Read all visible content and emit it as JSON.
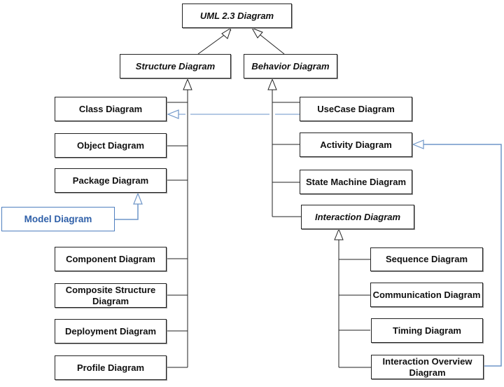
{
  "diagram": {
    "title": "UML 2.3 Diagram",
    "nodes": [
      {
        "id": "uml",
        "label": "UML 2.3 Diagram",
        "abstract": true
      },
      {
        "id": "structure",
        "label": "Structure Diagram",
        "abstract": true
      },
      {
        "id": "behavior",
        "label": "Behavior Diagram",
        "abstract": true
      },
      {
        "id": "class",
        "label": "Class Diagram",
        "abstract": false
      },
      {
        "id": "object",
        "label": "Object Diagram",
        "abstract": false
      },
      {
        "id": "package",
        "label": "Package Diagram",
        "abstract": false
      },
      {
        "id": "model",
        "label": "Model Diagram",
        "abstract": false,
        "highlight": true
      },
      {
        "id": "component",
        "label": "Component Diagram",
        "abstract": false
      },
      {
        "id": "composite",
        "label": "Composite Structure Diagram",
        "abstract": false
      },
      {
        "id": "deployment",
        "label": "Deployment Diagram",
        "abstract": false
      },
      {
        "id": "profile",
        "label": "Profile Diagram",
        "abstract": false
      },
      {
        "id": "usecase",
        "label": "UseCase Diagram",
        "abstract": false
      },
      {
        "id": "activity",
        "label": "Activity Diagram",
        "abstract": false
      },
      {
        "id": "statemachine",
        "label": "State Machine Diagram",
        "abstract": false
      },
      {
        "id": "interaction",
        "label": "Interaction Diagram",
        "abstract": true
      },
      {
        "id": "sequence",
        "label": "Sequence Diagram",
        "abstract": false
      },
      {
        "id": "communication",
        "label": "Communication Diagram",
        "abstract": false
      },
      {
        "id": "timing",
        "label": "Timing Diagram",
        "abstract": false
      },
      {
        "id": "interactionoverview",
        "label": "Interaction Overview Diagram",
        "abstract": false
      }
    ],
    "generalizations": [
      {
        "child": "structure",
        "parent": "uml"
      },
      {
        "child": "behavior",
        "parent": "uml"
      },
      {
        "child": "class",
        "parent": "structure"
      },
      {
        "child": "object",
        "parent": "structure"
      },
      {
        "child": "package",
        "parent": "structure"
      },
      {
        "child": "component",
        "parent": "structure"
      },
      {
        "child": "composite",
        "parent": "structure"
      },
      {
        "child": "deployment",
        "parent": "structure"
      },
      {
        "child": "profile",
        "parent": "structure"
      },
      {
        "child": "usecase",
        "parent": "behavior"
      },
      {
        "child": "activity",
        "parent": "behavior"
      },
      {
        "child": "statemachine",
        "parent": "behavior"
      },
      {
        "child": "interaction",
        "parent": "behavior"
      },
      {
        "child": "sequence",
        "parent": "interaction"
      },
      {
        "child": "communication",
        "parent": "interaction"
      },
      {
        "child": "timing",
        "parent": "interaction"
      },
      {
        "child": "interactionoverview",
        "parent": "interaction"
      }
    ],
    "highlighted_generalizations": [
      {
        "child": "model",
        "parent": "package"
      },
      {
        "child": "usecase",
        "parent": "class"
      },
      {
        "child": "interactionoverview",
        "parent": "activity"
      }
    ],
    "colors": {
      "line": "#222222",
      "highlight_line": "#6f96c8",
      "highlight_text": "#2e5fa8",
      "highlight_border": "#4f7fbf"
    }
  },
  "labels": {
    "uml": "UML 2.3 Diagram",
    "structure": "Structure Diagram",
    "behavior": "Behavior Diagram",
    "class": "Class Diagram",
    "object": "Object Diagram",
    "package": "Package Diagram",
    "model": "Model Diagram",
    "component": "Component Diagram",
    "composite": "Composite Structure Diagram",
    "deployment": "Deployment Diagram",
    "profile": "Profile Diagram",
    "usecase": "UseCase Diagram",
    "activity": "Activity Diagram",
    "statemachine": "State Machine Diagram",
    "interaction": "Interaction Diagram",
    "sequence": "Sequence Diagram",
    "communication": "Communication Diagram",
    "timing": "Timing Diagram",
    "interactionoverview": "Interaction Overview Diagram"
  }
}
